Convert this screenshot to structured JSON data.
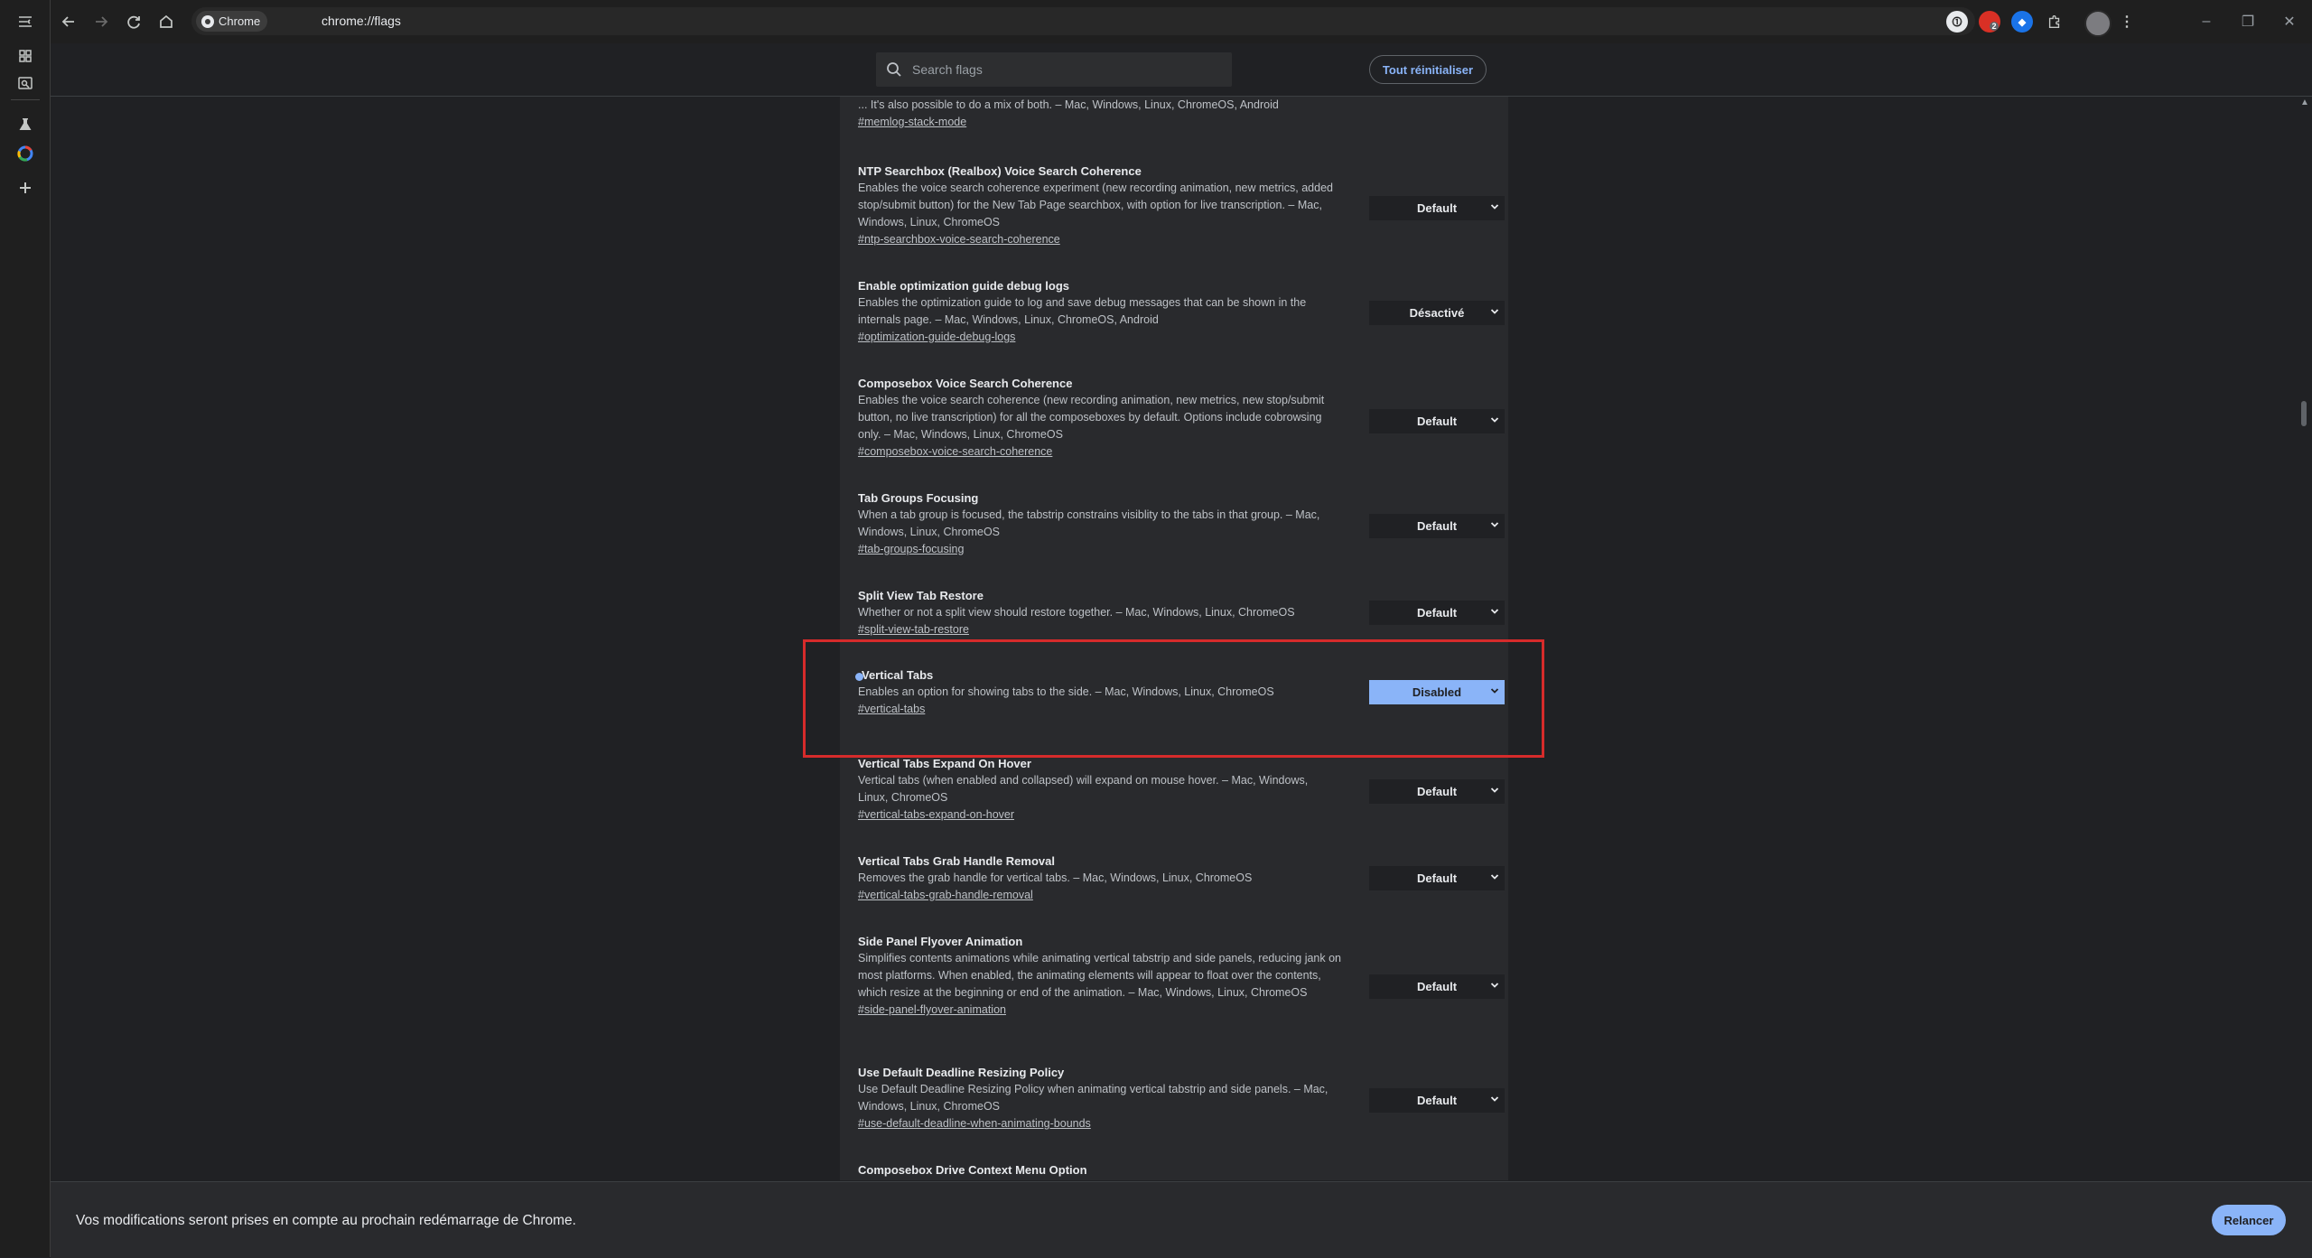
{
  "browser": {
    "chip_label": "Chrome",
    "url": "chrome://flags",
    "avatar_initial": "",
    "notification_badge": "2"
  },
  "flags_page": {
    "search_placeholder": "Search flags",
    "reset_all_label": "Tout réinitialiser"
  },
  "flags": [
    {
      "name": "",
      "description": "... It's also possible to do a mix of both. – Mac, Windows, Linux, ChromeOS, Android",
      "link": "#memlog-stack-mode",
      "value": ""
    },
    {
      "name": "NTP Searchbox (Realbox) Voice Search Coherence",
      "description": "Enables the voice search coherence experiment (new recording animation, new metrics, added stop/submit button) for the New Tab Page searchbox, with option for live transcription. – Mac, Windows, Linux, ChromeOS",
      "link": "#ntp-searchbox-voice-search-coherence",
      "value": "Default"
    },
    {
      "name": "Enable optimization guide debug logs",
      "description": "Enables the optimization guide to log and save debug messages that can be shown in the internals page. – Mac, Windows, Linux, ChromeOS, Android",
      "link": "#optimization-guide-debug-logs",
      "value": "Désactivé"
    },
    {
      "name": "Composebox Voice Search Coherence",
      "description": "Enables the voice search coherence (new recording animation, new metrics, new stop/submit button, no live transcription) for all the composeboxes by default. Options include cobrowsing only. – Mac, Windows, Linux, ChromeOS",
      "link": "#composebox-voice-search-coherence",
      "value": "Default"
    },
    {
      "name": "Tab Groups Focusing",
      "description": "When a tab group is focused, the tabstrip constrains visiblity to the tabs in that group. – Mac, Windows, Linux, ChromeOS",
      "link": "#tab-groups-focusing",
      "value": "Default"
    },
    {
      "name": "Split View Tab Restore",
      "description": "Whether or not a split view should restore together. – Mac, Windows, Linux, ChromeOS",
      "link": "#split-view-tab-restore",
      "value": "Default"
    },
    {
      "name": "Vertical Tabs",
      "description": "Enables an option for showing tabs to the side. – Mac, Windows, Linux, ChromeOS",
      "link": "#vertical-tabs",
      "value": "Disabled"
    },
    {
      "name": "Vertical Tabs Expand On Hover",
      "description": "Vertical tabs (when enabled and collapsed) will expand on mouse hover. – Mac, Windows, Linux, ChromeOS",
      "link": "#vertical-tabs-expand-on-hover",
      "value": "Default"
    },
    {
      "name": "Vertical Tabs Grab Handle Removal",
      "description": "Removes the grab handle for vertical tabs. – Mac, Windows, Linux, ChromeOS",
      "link": "#vertical-tabs-grab-handle-removal",
      "value": "Default"
    },
    {
      "name": "Side Panel Flyover Animation",
      "description": "Simplifies contents animations while animating vertical tabstrip and side panels, reducing jank on most platforms. When enabled, the animating elements will appear to float over the contents, which resize at the beginning or end of the animation. – Mac, Windows, Linux, ChromeOS",
      "link": "#side-panel-flyover-animation",
      "value": "Default"
    },
    {
      "name": "Use Default Deadline Resizing Policy",
      "description": "Use Default Deadline Resizing Policy when animating vertical tabstrip and side panels. – Mac, Windows, Linux, ChromeOS",
      "link": "#use-default-deadline-when-animating-bounds",
      "value": "Default"
    },
    {
      "name": "Composebox Drive Context Menu Option",
      "description": "",
      "link": "",
      "value": ""
    }
  ],
  "bottom_bar": {
    "message": "Vos modifications seront prises en compte au prochain redémarrage de Chrome.",
    "relaunch_label": "Relancer"
  },
  "colors": {
    "accent": "#8ab4f8",
    "highlight": "#d62b2b",
    "background": "#202124",
    "panel": "#292a2d"
  }
}
